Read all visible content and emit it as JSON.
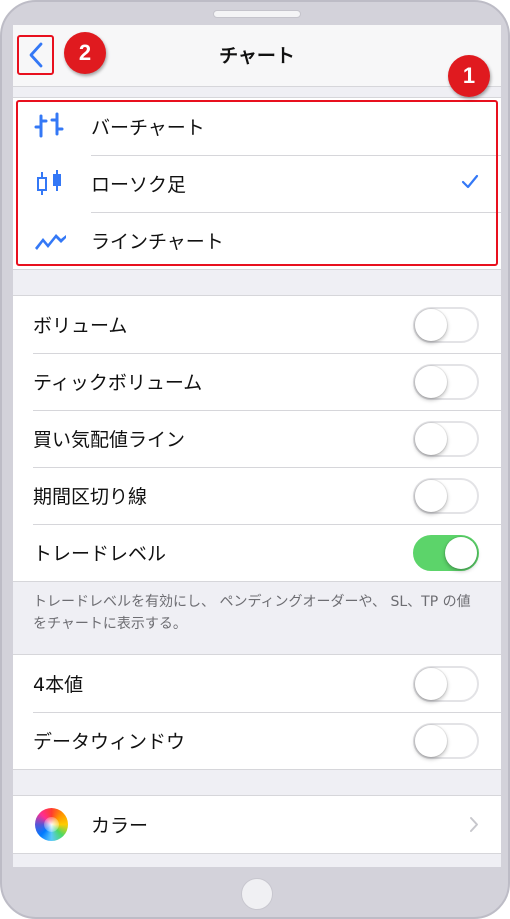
{
  "nav": {
    "title": "チャート"
  },
  "callouts": {
    "one": "1",
    "two": "2"
  },
  "chart_types": [
    {
      "label": "バーチャート",
      "icon": "bar-chart-icon",
      "selected": false
    },
    {
      "label": "ローソク足",
      "icon": "candlestick-icon",
      "selected": true
    },
    {
      "label": "ラインチャート",
      "icon": "line-chart-icon",
      "selected": false
    }
  ],
  "display_settings": [
    {
      "label": "ボリューム",
      "on": false
    },
    {
      "label": "ティックボリューム",
      "on": false
    },
    {
      "label": "買い気配値ライン",
      "on": false
    },
    {
      "label": "期間区切り線",
      "on": false
    },
    {
      "label": "トレードレベル",
      "on": true
    }
  ],
  "footnote": "トレードレベルを有効にし、 ペンディングオーダーや、 SL、TP の値をチャートに表示する。",
  "more_settings": [
    {
      "label": "4本値",
      "on": false
    },
    {
      "label": "データウィンドウ",
      "on": false
    }
  ],
  "color_row": {
    "label": "カラー",
    "icon": "color-wheel-icon"
  },
  "colors": {
    "accent": "#3478f6",
    "toggle_on": "#5cd46a",
    "highlight": "#e8101e"
  }
}
